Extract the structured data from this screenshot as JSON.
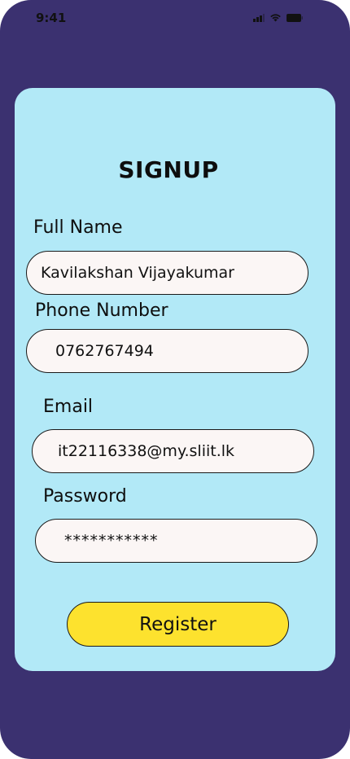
{
  "status_bar": {
    "time": "9:41",
    "icons": [
      "cellular-signal-icon",
      "wifi-icon",
      "battery-icon"
    ]
  },
  "form": {
    "title": "SIGNUP",
    "fields": {
      "full_name": {
        "label": "Full Name",
        "value": "Kavilakshan Vijayakumar"
      },
      "phone": {
        "label": "Phone Number",
        "value": "0762767494"
      },
      "email": {
        "label": "Email",
        "value": "it22116338@my.sliit.lk"
      },
      "password": {
        "label": "Password",
        "value": "***********"
      }
    },
    "register_label": "Register"
  },
  "colors": {
    "background": "#3b3170",
    "card": "#b2e9f7",
    "input": "#fbf6f5",
    "button": "#fde22e",
    "text": "#0e0e0e"
  }
}
